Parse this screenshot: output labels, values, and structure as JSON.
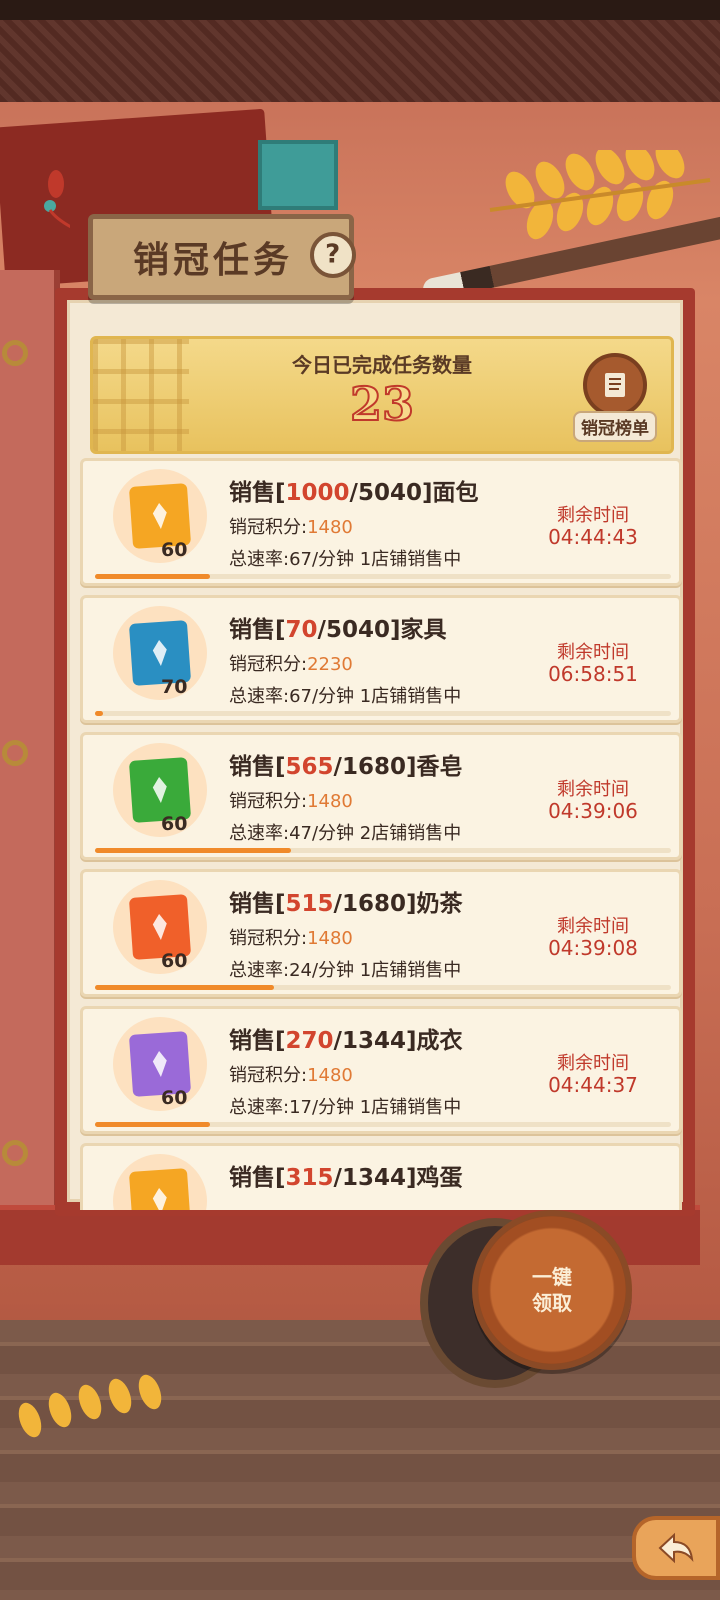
{
  "title": "销冠任务",
  "help_icon": "?",
  "header": {
    "label": "今日已完成任务数量",
    "count": "23",
    "rank_label": "销冠榜单"
  },
  "time_label": "剩余时间",
  "tasks": [
    {
      "prefix": "销售[",
      "current": "1000",
      "sep": "/",
      "target": "5040",
      "suffix": "]面包",
      "points_label": "销冠积分:",
      "points": "1480",
      "rate": "总速率:67/分钟 1店铺销售中",
      "time": "04:44:43",
      "level": "60",
      "progress": 0.2,
      "color": "#f5a623",
      "icon": "wheat-icon"
    },
    {
      "prefix": "销售[",
      "current": "70",
      "sep": "/",
      "target": "5040",
      "suffix": "]家具",
      "points_label": "销冠积分:",
      "points": "2230",
      "rate": "总速率:67/分钟 1店铺销售中",
      "time": "06:58:51",
      "level": "70",
      "progress": 0.014,
      "color": "#2a8fc2",
      "icon": "furniture-icon"
    },
    {
      "prefix": "销售[",
      "current": "565",
      "sep": "/",
      "target": "1680",
      "suffix": "]香皂",
      "points_label": "销冠积分:",
      "points": "1480",
      "rate": "总速率:47/分钟 2店铺销售中",
      "time": "04:39:06",
      "level": "60",
      "progress": 0.34,
      "color": "#3aaa3a",
      "icon": "soap-icon"
    },
    {
      "prefix": "销售[",
      "current": "515",
      "sep": "/",
      "target": "1680",
      "suffix": "]奶茶",
      "points_label": "销冠积分:",
      "points": "1480",
      "rate": "总速率:24/分钟 1店铺销售中",
      "time": "04:39:08",
      "level": "60",
      "progress": 0.31,
      "color": "#f0602a",
      "icon": "milk-tea-icon"
    },
    {
      "prefix": "销售[",
      "current": "270",
      "sep": "/",
      "target": "1344",
      "suffix": "]成衣",
      "points_label": "销冠积分:",
      "points": "1480",
      "rate": "总速率:17/分钟 1店铺销售中",
      "time": "04:44:37",
      "level": "60",
      "progress": 0.2,
      "color": "#9a6ad8",
      "icon": "clothes-icon"
    },
    {
      "prefix": "销售[",
      "current": "315",
      "sep": "/",
      "target": "1344",
      "suffix": "]鸡蛋",
      "points_label": "",
      "points": "",
      "rate": "",
      "time": "",
      "level": "",
      "progress": 0,
      "color": "#f5a623",
      "icon": "egg-icon"
    }
  ],
  "claim_button": {
    "line1": "一键",
    "line2": "领取"
  },
  "back_icon": "back-arrow-icon"
}
